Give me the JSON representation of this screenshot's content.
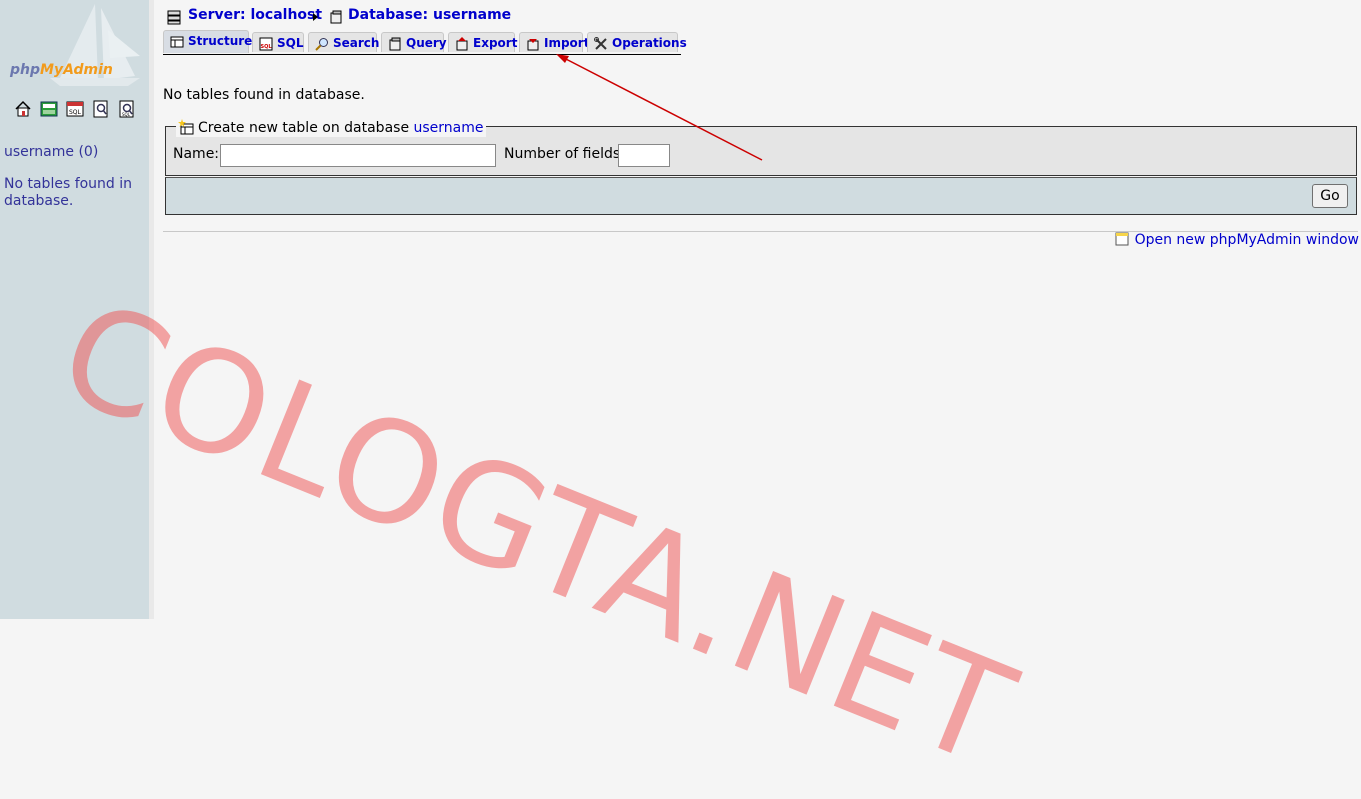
{
  "sidebar": {
    "logo": {
      "text_php": "php",
      "text_my": "My",
      "text_admin": "Admin"
    },
    "icons": [
      "home-icon",
      "exit-icon",
      "sql-query-icon",
      "documentation-icon",
      "sql-documentation-icon"
    ],
    "database_link": "username (0)",
    "notice": "No tables found in database."
  },
  "breadcrumb": {
    "server_label": "Server: localhost",
    "database_label": "Database: username"
  },
  "tabs": [
    {
      "label": "Structure",
      "icon": "structure-icon",
      "active": true
    },
    {
      "label": "SQL",
      "icon": "sql-icon"
    },
    {
      "label": "Search",
      "icon": "search-icon"
    },
    {
      "label": "Query",
      "icon": "query-icon"
    },
    {
      "label": "Export",
      "icon": "export-icon"
    },
    {
      "label": "Import",
      "icon": "import-icon"
    },
    {
      "label": "Operations",
      "icon": "operations-icon"
    }
  ],
  "main": {
    "notice": "No tables found in database.",
    "create_table": {
      "legend_prefix": "Create new table on database",
      "database": "username",
      "name_label": "Name:",
      "name_value": "",
      "fields_label": "Number of fields:",
      "fields_value": "",
      "go_label": "Go"
    },
    "open_new_window": "Open new phpMyAdmin window"
  },
  "watermark": "COLOGTA.NET",
  "colors": {
    "sidebar_bg": "#d0dce0",
    "link": "#0000cc",
    "annotation_arrow": "#cc0000",
    "watermark": "#f05050"
  }
}
